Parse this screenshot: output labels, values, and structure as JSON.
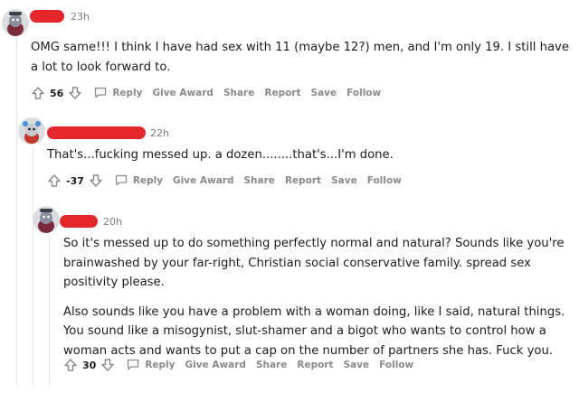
{
  "comments": [
    {
      "time": "23h",
      "body": [
        "OMG same!!! I think I have had sex with 11 (maybe 12?) men, and I'm only 19. I still have a lot to look forward to."
      ],
      "score": "56"
    },
    {
      "time": "22h",
      "body": [
        "That's...fucking messed up. a dozen........that's...I'm done."
      ],
      "score": "-37"
    },
    {
      "time": "20h",
      "body": [
        "So it's messed up to do something perfectly normal and natural? Sounds like you're brainwashed by your far-right, Christian social conservative family. spread sex positivity please.",
        "Also sounds like you have a problem with a woman doing, like I said, natural things. You sound like a misogynist, slut-shamer and a bigot who wants to control how a woman acts and wants to put a cap on the number of partners she has. Fuck you."
      ],
      "score": "30"
    }
  ],
  "actions": {
    "reply": "Reply",
    "give_award": "Give Award",
    "share": "Share",
    "report": "Report",
    "save": "Save",
    "follow": "Follow"
  },
  "colors": {
    "redaction": "#e3262b",
    "meta": "#7c7c7c",
    "action": "#878a8c"
  },
  "icons": [
    "avatar",
    "upvote-icon",
    "downvote-icon",
    "reply-icon"
  ]
}
